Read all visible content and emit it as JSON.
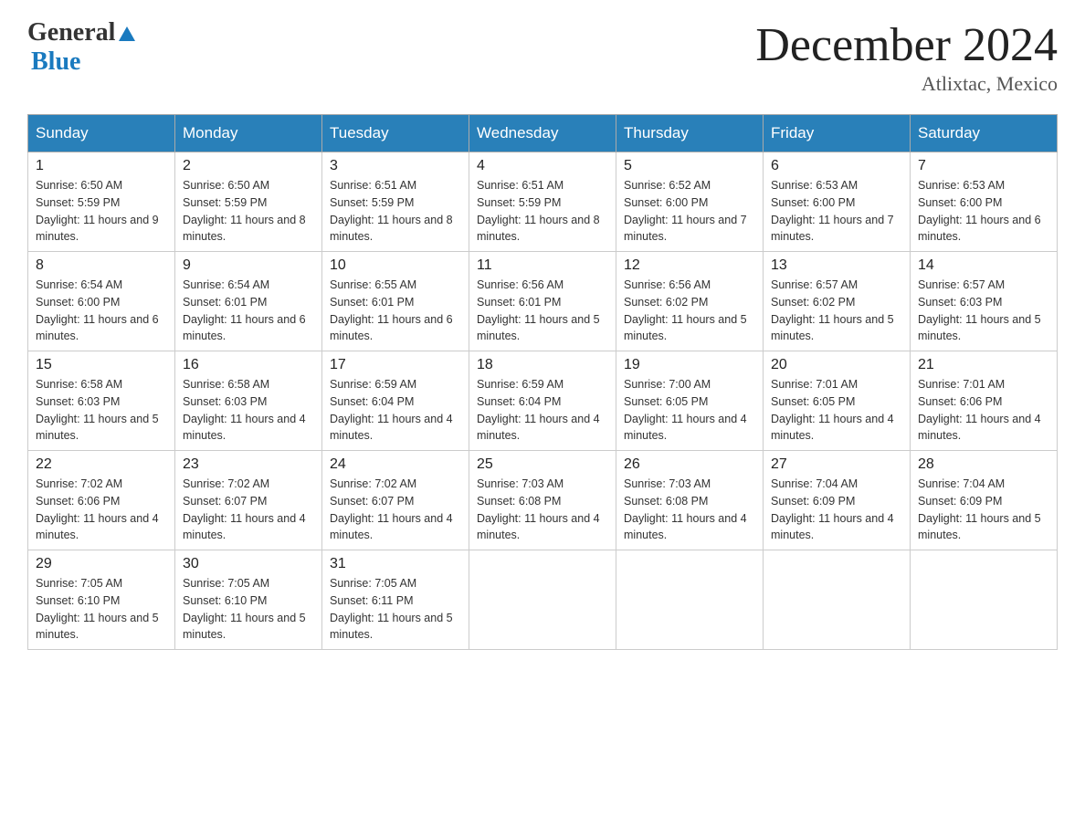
{
  "header": {
    "logo_general": "General",
    "logo_blue": "Blue",
    "month_title": "December 2024",
    "location": "Atlixtac, Mexico"
  },
  "calendar": {
    "days_of_week": [
      "Sunday",
      "Monday",
      "Tuesday",
      "Wednesday",
      "Thursday",
      "Friday",
      "Saturday"
    ],
    "weeks": [
      [
        {
          "day": 1,
          "sunrise": "6:50 AM",
          "sunset": "5:59 PM",
          "daylight": "11 hours and 9 minutes."
        },
        {
          "day": 2,
          "sunrise": "6:50 AM",
          "sunset": "5:59 PM",
          "daylight": "11 hours and 8 minutes."
        },
        {
          "day": 3,
          "sunrise": "6:51 AM",
          "sunset": "5:59 PM",
          "daylight": "11 hours and 8 minutes."
        },
        {
          "day": 4,
          "sunrise": "6:51 AM",
          "sunset": "5:59 PM",
          "daylight": "11 hours and 8 minutes."
        },
        {
          "day": 5,
          "sunrise": "6:52 AM",
          "sunset": "6:00 PM",
          "daylight": "11 hours and 7 minutes."
        },
        {
          "day": 6,
          "sunrise": "6:53 AM",
          "sunset": "6:00 PM",
          "daylight": "11 hours and 7 minutes."
        },
        {
          "day": 7,
          "sunrise": "6:53 AM",
          "sunset": "6:00 PM",
          "daylight": "11 hours and 6 minutes."
        }
      ],
      [
        {
          "day": 8,
          "sunrise": "6:54 AM",
          "sunset": "6:00 PM",
          "daylight": "11 hours and 6 minutes."
        },
        {
          "day": 9,
          "sunrise": "6:54 AM",
          "sunset": "6:01 PM",
          "daylight": "11 hours and 6 minutes."
        },
        {
          "day": 10,
          "sunrise": "6:55 AM",
          "sunset": "6:01 PM",
          "daylight": "11 hours and 6 minutes."
        },
        {
          "day": 11,
          "sunrise": "6:56 AM",
          "sunset": "6:01 PM",
          "daylight": "11 hours and 5 minutes."
        },
        {
          "day": 12,
          "sunrise": "6:56 AM",
          "sunset": "6:02 PM",
          "daylight": "11 hours and 5 minutes."
        },
        {
          "day": 13,
          "sunrise": "6:57 AM",
          "sunset": "6:02 PM",
          "daylight": "11 hours and 5 minutes."
        },
        {
          "day": 14,
          "sunrise": "6:57 AM",
          "sunset": "6:03 PM",
          "daylight": "11 hours and 5 minutes."
        }
      ],
      [
        {
          "day": 15,
          "sunrise": "6:58 AM",
          "sunset": "6:03 PM",
          "daylight": "11 hours and 5 minutes."
        },
        {
          "day": 16,
          "sunrise": "6:58 AM",
          "sunset": "6:03 PM",
          "daylight": "11 hours and 4 minutes."
        },
        {
          "day": 17,
          "sunrise": "6:59 AM",
          "sunset": "6:04 PM",
          "daylight": "11 hours and 4 minutes."
        },
        {
          "day": 18,
          "sunrise": "6:59 AM",
          "sunset": "6:04 PM",
          "daylight": "11 hours and 4 minutes."
        },
        {
          "day": 19,
          "sunrise": "7:00 AM",
          "sunset": "6:05 PM",
          "daylight": "11 hours and 4 minutes."
        },
        {
          "day": 20,
          "sunrise": "7:01 AM",
          "sunset": "6:05 PM",
          "daylight": "11 hours and 4 minutes."
        },
        {
          "day": 21,
          "sunrise": "7:01 AM",
          "sunset": "6:06 PM",
          "daylight": "11 hours and 4 minutes."
        }
      ],
      [
        {
          "day": 22,
          "sunrise": "7:02 AM",
          "sunset": "6:06 PM",
          "daylight": "11 hours and 4 minutes."
        },
        {
          "day": 23,
          "sunrise": "7:02 AM",
          "sunset": "6:07 PM",
          "daylight": "11 hours and 4 minutes."
        },
        {
          "day": 24,
          "sunrise": "7:02 AM",
          "sunset": "6:07 PM",
          "daylight": "11 hours and 4 minutes."
        },
        {
          "day": 25,
          "sunrise": "7:03 AM",
          "sunset": "6:08 PM",
          "daylight": "11 hours and 4 minutes."
        },
        {
          "day": 26,
          "sunrise": "7:03 AM",
          "sunset": "6:08 PM",
          "daylight": "11 hours and 4 minutes."
        },
        {
          "day": 27,
          "sunrise": "7:04 AM",
          "sunset": "6:09 PM",
          "daylight": "11 hours and 4 minutes."
        },
        {
          "day": 28,
          "sunrise": "7:04 AM",
          "sunset": "6:09 PM",
          "daylight": "11 hours and 5 minutes."
        }
      ],
      [
        {
          "day": 29,
          "sunrise": "7:05 AM",
          "sunset": "6:10 PM",
          "daylight": "11 hours and 5 minutes."
        },
        {
          "day": 30,
          "sunrise": "7:05 AM",
          "sunset": "6:10 PM",
          "daylight": "11 hours and 5 minutes."
        },
        {
          "day": 31,
          "sunrise": "7:05 AM",
          "sunset": "6:11 PM",
          "daylight": "11 hours and 5 minutes."
        },
        null,
        null,
        null,
        null
      ]
    ]
  }
}
